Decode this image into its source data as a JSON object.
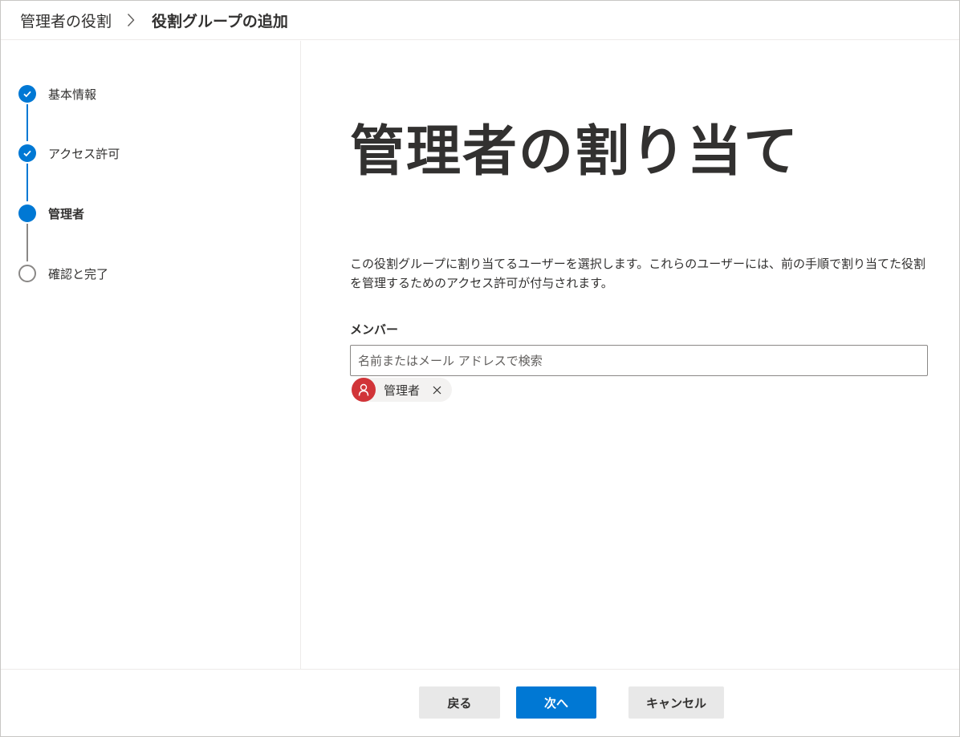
{
  "breadcrumb": {
    "root": "管理者の役割",
    "current": "役割グループの追加"
  },
  "steps": [
    {
      "label": "基本情報",
      "state": "done"
    },
    {
      "label": "アクセス許可",
      "state": "done"
    },
    {
      "label": "管理者",
      "state": "active"
    },
    {
      "label": "確認と完了",
      "state": "todo"
    }
  ],
  "main": {
    "title": "管理者の割り当て",
    "description": "この役割グループに割り当てるユーザーを選択します。これらのユーザーには、前の手順で割り当てた役割を管理するためのアクセス許可が付与されます。",
    "members_label": "メンバー",
    "search_placeholder": "名前またはメール アドレスで検索",
    "selected_members": [
      {
        "name": "管理者",
        "avatar_color": "#d13438"
      }
    ]
  },
  "footer": {
    "back_label": "戻る",
    "next_label": "次へ",
    "cancel_label": "キャンセル"
  },
  "colors": {
    "accent": "#0078d4",
    "avatar": "#d13438"
  }
}
